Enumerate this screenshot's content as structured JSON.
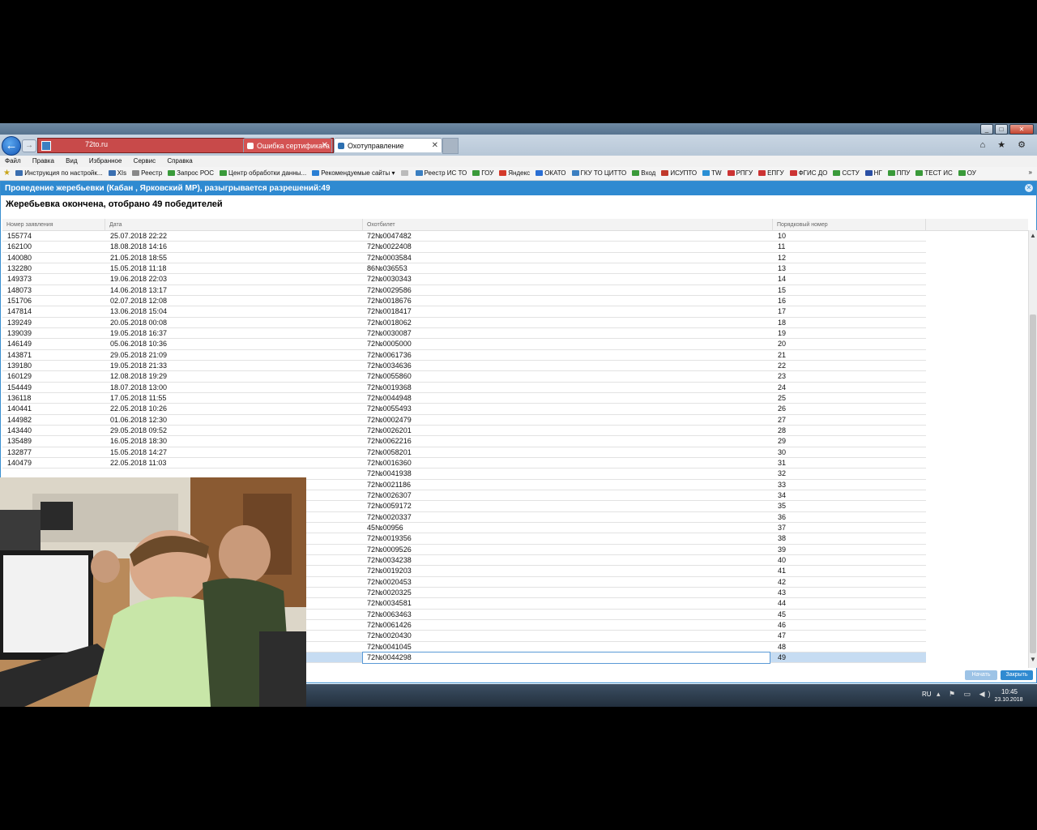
{
  "browser": {
    "address_url": "72to.ru",
    "address_tools": "ρ ▾ ↻",
    "tabs": [
      {
        "label": "Ошибка сертификата"
      },
      {
        "label": "Охотуправление"
      }
    ],
    "window_controls": [
      "_",
      "□",
      "✕"
    ],
    "nav_icons": "⌂ ★ ⚙"
  },
  "menu": [
    "Файл",
    "Правка",
    "Вид",
    "Избранное",
    "Сервис",
    "Справка"
  ],
  "favorites": [
    {
      "label": "Инструкция по настройк...",
      "color": "#3b6fb0"
    },
    {
      "label": "XIs",
      "color": "#3b6fb0"
    },
    {
      "label": "Реестр",
      "color": "#888888"
    },
    {
      "label": "Запрос РОС",
      "color": "#3a9a3a"
    },
    {
      "label": "Центр обработки данны...",
      "color": "#3a9a3a"
    },
    {
      "label": "Рекомендуемые сайты ▾",
      "color": "#2a7fd4"
    },
    {
      "label": "",
      "color": "#bbbbbb"
    },
    {
      "label": "Реестр ИС ТО",
      "color": "#3b7fc1"
    },
    {
      "label": "ГОУ",
      "color": "#3a9a3a"
    },
    {
      "label": "Яндекс",
      "color": "#d43a2a"
    },
    {
      "label": "ОКАТО",
      "color": "#2a6fd4"
    },
    {
      "label": "ГКУ ТО ЦИТТО",
      "color": "#3b7fc1"
    },
    {
      "label": "Вход",
      "color": "#3a9a3a"
    },
    {
      "label": "ИСУПТО",
      "color": "#c0392b"
    },
    {
      "label": "TW",
      "color": "#2a8fd4"
    },
    {
      "label": "РПГУ",
      "color": "#cc3333"
    },
    {
      "label": "ЕПГУ",
      "color": "#cc3333"
    },
    {
      "label": "ФГИС ДО",
      "color": "#cc3333"
    },
    {
      "label": "ССТУ",
      "color": "#3a9a3a"
    },
    {
      "label": "НГ",
      "color": "#2a4fa4"
    },
    {
      "label": "ППУ",
      "color": "#3a9a3a"
    },
    {
      "label": "ТЕСТ ИС",
      "color": "#3a9a3a"
    },
    {
      "label": "ОУ",
      "color": "#3a9a3a"
    }
  ],
  "dialog": {
    "title": "Проведение жеребьевки (Кабан , Ярковский МР), разыгрывается разрешений:49",
    "result": "Жеребьевка окончена, отобрано 49 победителей",
    "columns": [
      "Номер заявления",
      "Дата",
      "Охотбилет",
      "Порядковый номер"
    ],
    "rows": [
      {
        "id": "155774",
        "date": "25.07.2018 22:22",
        "ticket": "72№0047482",
        "num": "10"
      },
      {
        "id": "162100",
        "date": "18.08.2018 14:16",
        "ticket": "72№0022408",
        "num": "11"
      },
      {
        "id": "140080",
        "date": "21.05.2018 18:55",
        "ticket": "72№0003584",
        "num": "12"
      },
      {
        "id": "132280",
        "date": "15.05.2018 11:18",
        "ticket": "86№036553",
        "num": "13"
      },
      {
        "id": "149373",
        "date": "19.06.2018 22:03",
        "ticket": "72№0030343",
        "num": "14"
      },
      {
        "id": "148073",
        "date": "14.06.2018 13:17",
        "ticket": "72№0029586",
        "num": "15"
      },
      {
        "id": "151706",
        "date": "02.07.2018 12:08",
        "ticket": "72№0018676",
        "num": "16"
      },
      {
        "id": "147814",
        "date": "13.06.2018 15:04",
        "ticket": "72№0018417",
        "num": "17"
      },
      {
        "id": "139249",
        "date": "20.05.2018 00:08",
        "ticket": "72№0018062",
        "num": "18"
      },
      {
        "id": "139039",
        "date": "19.05.2018 16:37",
        "ticket": "72№0030087",
        "num": "19"
      },
      {
        "id": "146149",
        "date": "05.06.2018 10:36",
        "ticket": "72№0005000",
        "num": "20"
      },
      {
        "id": "143871",
        "date": "29.05.2018 21:09",
        "ticket": "72№0061736",
        "num": "21"
      },
      {
        "id": "139180",
        "date": "19.05.2018 21:33",
        "ticket": "72№0034636",
        "num": "22"
      },
      {
        "id": "160129",
        "date": "12.08.2018 19:29",
        "ticket": "72№0055860",
        "num": "23"
      },
      {
        "id": "154449",
        "date": "18.07.2018 13:00",
        "ticket": "72№0019368",
        "num": "24"
      },
      {
        "id": "136118",
        "date": "17.05.2018 11:55",
        "ticket": "72№0044948",
        "num": "25"
      },
      {
        "id": "140441",
        "date": "22.05.2018 10:26",
        "ticket": "72№0055493",
        "num": "26"
      },
      {
        "id": "144982",
        "date": "01.06.2018 12:30",
        "ticket": "72№0002479",
        "num": "27"
      },
      {
        "id": "143440",
        "date": "29.05.2018 09:52",
        "ticket": "72№0026201",
        "num": "28"
      },
      {
        "id": "135489",
        "date": "16.05.2018 18:30",
        "ticket": "72№0062216",
        "num": "29"
      },
      {
        "id": "132877",
        "date": "15.05.2018 14:27",
        "ticket": "72№0058201",
        "num": "30"
      },
      {
        "id": "140479",
        "date": "22.05.2018 11:03",
        "ticket": "72№0016360",
        "num": "31"
      },
      {
        "id": "",
        "date": "",
        "ticket": "72№0041938",
        "num": "32"
      },
      {
        "id": "",
        "date": "",
        "ticket": "72№0021186",
        "num": "33"
      },
      {
        "id": "",
        "date": "",
        "ticket": "72№0026307",
        "num": "34"
      },
      {
        "id": "",
        "date": "",
        "ticket": "72№0059172",
        "num": "35"
      },
      {
        "id": "",
        "date": "",
        "ticket": "72№0020337",
        "num": "36"
      },
      {
        "id": "",
        "date": "",
        "ticket": "45№00956",
        "num": "37"
      },
      {
        "id": "",
        "date": "",
        "ticket": "72№0019356",
        "num": "38"
      },
      {
        "id": "",
        "date": "",
        "ticket": "72№0009526",
        "num": "39"
      },
      {
        "id": "",
        "date": "",
        "ticket": "72№0034238",
        "num": "40"
      },
      {
        "id": "",
        "date": "",
        "ticket": "72№0019203",
        "num": "41"
      },
      {
        "id": "",
        "date": "",
        "ticket": "72№0020453",
        "num": "42"
      },
      {
        "id": "",
        "date": "",
        "ticket": "72№0020325",
        "num": "43"
      },
      {
        "id": "",
        "date": "",
        "ticket": "72№0034581",
        "num": "44"
      },
      {
        "id": "",
        "date": "",
        "ticket": "72№0063463",
        "num": "45"
      },
      {
        "id": "",
        "date": "",
        "ticket": "72№0061426",
        "num": "46"
      },
      {
        "id": "",
        "date": "",
        "ticket": "72№0020430",
        "num": "47"
      },
      {
        "id": "",
        "date": "",
        "ticket": "72№0041045",
        "num": "48"
      },
      {
        "id": "",
        "date": "",
        "ticket": "72№0044298",
        "num": "49",
        "selected": true
      }
    ],
    "buttons": {
      "start": "Начать",
      "close": "Закрыть"
    }
  },
  "taskbar": {
    "lang": "RU",
    "tray_icons": "▴ ⚑ ▭ ◀)",
    "time": "10:45",
    "date": "23.10.2018"
  },
  "colors": {
    "dialog_header": "#2f8ad1",
    "selected_row": "#c6dcf2",
    "certificate_error": "#d45353"
  }
}
